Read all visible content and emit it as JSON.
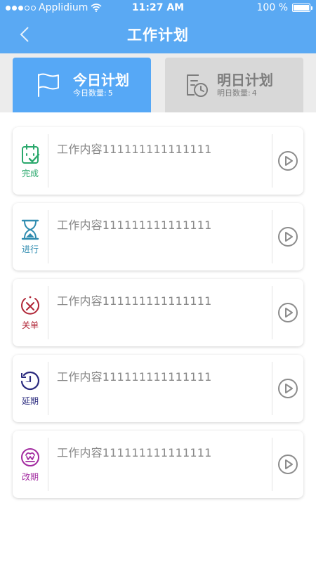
{
  "status_bar": {
    "carrier": "Applidium",
    "time": "11:27 AM",
    "battery": "100 %",
    "battery_level": 1.0
  },
  "nav": {
    "title": "工作计划",
    "back_icon": "chevron-left-icon"
  },
  "tabs": [
    {
      "label": "今日计划",
      "count_label": "今日数量:",
      "count": "5",
      "icon": "flag-icon",
      "active": true
    },
    {
      "label": "明日计划",
      "count_label": "明日数量:",
      "count": "4",
      "icon": "calendar-clock-icon",
      "active": false
    }
  ],
  "tasks": [
    {
      "status": "完成",
      "icon": "clipboard-check-icon",
      "color": "#2aa86c",
      "content": "工作内容111111111111111"
    },
    {
      "status": "进行",
      "icon": "hourglass-icon",
      "color": "#2f8cb0",
      "content": "工作内容111111111111111"
    },
    {
      "status": "关单",
      "icon": "close-circle-icon",
      "color": "#b02637",
      "content": "工作内容111111111111111"
    },
    {
      "status": "延期",
      "icon": "clock-icon",
      "color": "#2a2a7e",
      "content": "工作内容111111111111111"
    },
    {
      "status": "改期",
      "icon": "reschedule-icon",
      "color": "#a22aa0",
      "content": "工作内容111111111111111"
    }
  ],
  "colors": {
    "primary": "#5aa9f3",
    "tab_inactive": "#d8d8d8",
    "play_icon": "#8c8c8c"
  }
}
